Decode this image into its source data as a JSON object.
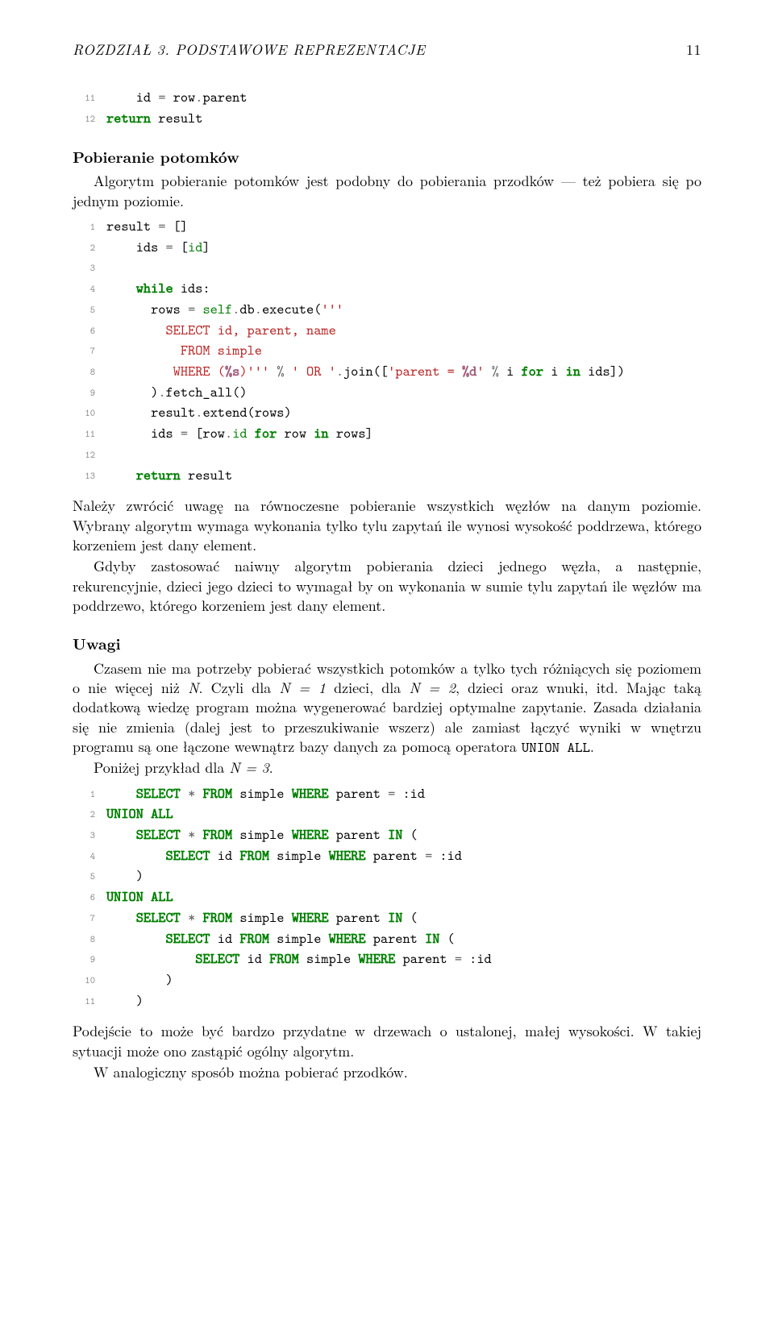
{
  "header": {
    "running": "ROZDZIAŁ 3.  PODSTAWOWE REPREZENTACJE",
    "page_number": "11"
  },
  "code1": {
    "l11a": "11",
    "l11b": "    id ",
    "l11c": "=",
    "l11d": " row",
    "l11e": ".",
    "l11f": "parent",
    "l12a": "12",
    "l12b": "return",
    "l12c": " result"
  },
  "section1": {
    "title": "Pobieranie potomków",
    "p1": "Algorytm pobieranie potomków jest podobny do pobierania przodków — też pobiera się po jednym poziomie."
  },
  "code2": {
    "l1a": "1",
    "l1b": "result ",
    "l1c": "=",
    "l1d": " []",
    "l2a": "2",
    "l2b": "    ids ",
    "l2c": "=",
    "l2d": " [",
    "l2e": "id",
    "l2f": "]",
    "l3a": "3",
    "l4a": "4",
    "l4b": "    ",
    "l4c": "while",
    "l4d": " ids:",
    "l5a": "5",
    "l5b": "      rows ",
    "l5c": "=",
    "l5d": " ",
    "l5e": "self",
    "l5f": ".",
    "l5g": "db",
    "l5h": ".",
    "l5i": "execute(",
    "l5j": "'''",
    "l6a": "6",
    "l6b": "        SELECT id, parent, name",
    "l7a": "7",
    "l7b": "          FROM simple",
    "l8a": "8",
    "l8b": "         WHERE (",
    "l8c": "%s",
    "l8d": ")'''",
    "l8e": " ",
    "l8f": "%",
    "l8g": " ",
    "l8h": "' OR '",
    "l8i": ".",
    "l8j": "join([",
    "l8k": "'parent = ",
    "l8l": "%d",
    "l8m": "'",
    "l8n": " ",
    "l8o": "%",
    "l8p": " i ",
    "l8q": "for",
    "l8r": " i ",
    "l8s": "in",
    "l8t": " ids])",
    "l9a": "9",
    "l9b": "      )",
    "l9c": ".",
    "l9d": "fetch_all()",
    "l10a": "10",
    "l10b": "      result",
    "l10c": ".",
    "l10d": "extend(rows)",
    "l11a": "11",
    "l11b": "      ids ",
    "l11c": "=",
    "l11d": " [row",
    "l11e": ".",
    "l11f": "id",
    "l11g": " ",
    "l11h": "for",
    "l11i": " row ",
    "l11j": "in",
    "l11k": " rows]",
    "l12a": "12",
    "l13a": "13",
    "l13b": "    ",
    "l13c": "return",
    "l13d": " result"
  },
  "para2": {
    "p1": "Należy zwrócić uwagę na równoczesne pobieranie wszystkich węzłów na danym poziomie. Wybrany algorytm wymaga wykonania tylko tylu zapytań ile wynosi wysokość poddrzewa, którego korzeniem jest dany element.",
    "p2": "Gdyby zastosować naiwny algorytm pobierania dzieci jednego węzła, a następnie, rekurencyjnie, dzieci jego dzieci to wymagał by on wykonania w sumie tylu zapytań ile węzłów ma poddrzewo, którego korzeniem jest dany element."
  },
  "section2": {
    "title": "Uwagi",
    "p1a": "Czasem nie ma potrzeby pobierać wszystkich potomków a tylko tych różniących się poziomem o nie więcej niż ",
    "p1b": ". Czyli dla ",
    "p1c": " dzieci, dla ",
    "p1d": ", dzieci oraz wnuki, itd. Mając taką dodatkową wiedzę program można wygenerować bardziej optymalne zapytanie. Zasada działania się nie zmienia (dalej jest to przeszukiwanie wszerz) ale zamiast łączyć wyniki w wnętrzu programu są one łączone wewnątrz bazy danych za pomocą operatora ",
    "p1e": "UNION ALL",
    "p1f": ".",
    "N": "N",
    "eq1": "N = 1",
    "eq2": "N = 2",
    "p2a": "Poniżej przykład dla ",
    "eq3": "N = 3",
    "p2b": "."
  },
  "code3": {
    "l1a": "1",
    "l1b": "    ",
    "l1c": "SELECT",
    "l1d": " ",
    "l1e": "*",
    "l1f": " ",
    "l1g": "FROM",
    "l1h": " simple ",
    "l1i": "WHERE",
    "l1j": " parent ",
    "l1k": "=",
    "l1l": " :id",
    "l2a": "2",
    "l2b": "UNION ALL",
    "l3a": "3",
    "l3b": "    ",
    "l3c": "SELECT",
    "l3d": " ",
    "l3e": "*",
    "l3f": " ",
    "l3g": "FROM",
    "l3h": " simple ",
    "l3i": "WHERE",
    "l3j": " parent ",
    "l3k": "IN",
    "l3l": " (",
    "l4a": "4",
    "l4b": "        ",
    "l4c": "SELECT",
    "l4d": " id ",
    "l4e": "FROM",
    "l4f": " simple ",
    "l4g": "WHERE",
    "l4h": " parent ",
    "l4i": "=",
    "l4j": " :id",
    "l5a": "5",
    "l5b": "    )",
    "l6a": "6",
    "l6b": "UNION ALL",
    "l7a": "7",
    "l7b": "    ",
    "l7c": "SELECT",
    "l7d": " ",
    "l7e": "*",
    "l7f": " ",
    "l7g": "FROM",
    "l7h": " simple ",
    "l7i": "WHERE",
    "l7j": " parent ",
    "l7k": "IN",
    "l7l": " (",
    "l8a": "8",
    "l8b": "        ",
    "l8c": "SELECT",
    "l8d": " id ",
    "l8e": "FROM",
    "l8f": " simple ",
    "l8g": "WHERE",
    "l8h": " parent ",
    "l8i": "IN",
    "l8j": " (",
    "l9a": "9",
    "l9b": "            ",
    "l9c": "SELECT",
    "l9d": " id ",
    "l9e": "FROM",
    "l9f": " simple ",
    "l9g": "WHERE",
    "l9h": " parent ",
    "l9i": "=",
    "l9j": " :id",
    "l10a": "10",
    "l10b": "        )",
    "l11a": "11",
    "l11b": "    )"
  },
  "para3": {
    "p1": "Podejście to może być bardzo przydatne w drzewach o ustalonej, małej wysokości. W takiej sytuacji może ono zastąpić ogólny algorytm.",
    "p2": "W analogiczny sposób można pobierać przodków."
  }
}
